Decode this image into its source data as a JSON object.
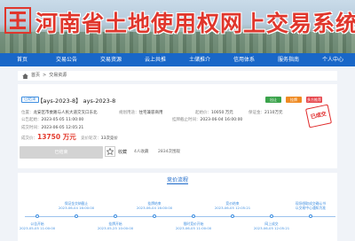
{
  "site": {
    "title": "河南省土地使用权网上交易系统"
  },
  "nav": {
    "items": [
      "首页",
      "交易公告",
      "交易资源",
      "云上共推",
      "土储推介",
      "信用体系",
      "服务指南",
      "个人中心"
    ]
  },
  "breadcrumb": {
    "home": "首页",
    "separator": ">",
    "current": "交易资源"
  },
  "listing": {
    "status": "已结束",
    "title": "【ays-2023-8】 ays-2023-8",
    "badges": [
      "出让",
      "挂牌",
      "多方推荐"
    ],
    "stamp": "已成交",
    "location": {
      "label": "位置：",
      "value": "龙安区市委路与人民大道交叉口东北"
    },
    "usage": {
      "label": "规划用途：",
      "value": "住宅兼容商用"
    },
    "starting_price": {
      "label": "起始价：",
      "value": "10050 万元"
    },
    "deposit": {
      "label": "保证金：",
      "value": "2110万元"
    },
    "announce_start": {
      "label": "公告起始：",
      "value": "2023-05-05 11:00:00"
    },
    "listing_end": {
      "label": "挂牌截止时间：",
      "value": "2023-06-04 16:00:00"
    },
    "deal_time": {
      "label": "成交时间：",
      "value": "2023-06-05 12:05:21"
    },
    "deal_price": {
      "label": "成交价：",
      "value": "13750 万元",
      "rounds_label": "竞价轮次：",
      "rounds": "33次竞价"
    },
    "action_button": "已结束",
    "favorite_label": "收藏",
    "favorites": "4人收藏",
    "views": "2834次围观"
  },
  "process": {
    "title": "竞价流程",
    "steps": [
      {
        "label": "公告开始",
        "time": "2023-05-05 11:00:00"
      },
      {
        "label": "保证金交纳截止",
        "time": "2023-06-04 16:00:00"
      },
      {
        "label": "挂牌开始",
        "time": "2023-05-25 10:00:00"
      },
      {
        "label": "挂牌结束",
        "time": "2023-06-04 16:00:00"
      },
      {
        "label": "限时竞价开始",
        "time": "2023-06-05 11:00:00"
      },
      {
        "label": "竞价结束",
        "time": "2023-06-05 12:05:21"
      },
      {
        "label": "网上成交",
        "time": "2023-06-05 12:05:21"
      },
      {
        "label": "现场领取成交确认书",
        "time": "以交易中心通知为准"
      }
    ]
  },
  "colors": {
    "brand_red": "#e0362c",
    "nav_blue": "#1967c8",
    "price_red": "#e33b2e",
    "accent_blue": "#3e8ee0"
  }
}
